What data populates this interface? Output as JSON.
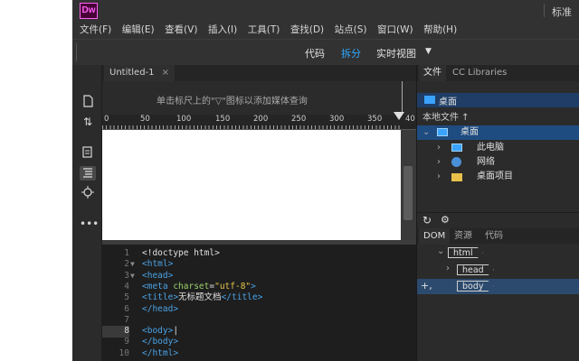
{
  "app": {
    "logo": "Dw",
    "workspace": "标准"
  },
  "menu": [
    "文件(F)",
    "编辑(E)",
    "查看(V)",
    "插入(I)",
    "工具(T)",
    "查找(D)",
    "站点(S)",
    "窗口(W)",
    "帮助(H)"
  ],
  "views": {
    "code": "代码",
    "split": "拆分",
    "live": "实时视图",
    "active": "拆分"
  },
  "document": {
    "tab_title": "Untitled-1",
    "tab_close": "×",
    "media_query_hint": "单击标尺上的\"▽\"图标以添加媒体查询"
  },
  "ruler": [
    "0",
    "50",
    "100",
    "150",
    "200",
    "250",
    "300",
    "350",
    "40"
  ],
  "code": [
    {
      "n": "1",
      "fold": "",
      "parts": [
        [
          "t-txt",
          "<!doctype html>"
        ]
      ]
    },
    {
      "n": "2",
      "fold": "▼",
      "parts": [
        [
          "t-tag",
          "<html>"
        ]
      ]
    },
    {
      "n": "3",
      "fold": "▼",
      "parts": [
        [
          "t-tag",
          "<head>"
        ]
      ]
    },
    {
      "n": "4",
      "fold": "",
      "parts": [
        [
          "t-tag",
          "<meta "
        ],
        [
          "t-attr",
          "charset"
        ],
        [
          "t-txt",
          "="
        ],
        [
          "t-str",
          "\"utf-8\""
        ],
        [
          "t-tag",
          ">"
        ]
      ]
    },
    {
      "n": "5",
      "fold": "",
      "parts": [
        [
          "t-tag",
          "<title>"
        ],
        [
          "t-txt",
          "无标题文档"
        ],
        [
          "t-tag",
          "</title>"
        ]
      ]
    },
    {
      "n": "6",
      "fold": "",
      "parts": [
        [
          "t-tag",
          "</head>"
        ]
      ]
    },
    {
      "n": "7",
      "fold": "",
      "parts": []
    },
    {
      "n": "8",
      "fold": "",
      "parts": [
        [
          "t-tag",
          "<body>"
        ],
        [
          "t-txt",
          "|"
        ]
      ],
      "highlight": true
    },
    {
      "n": "9",
      "fold": "",
      "parts": [
        [
          "t-tag",
          "</body>"
        ]
      ]
    },
    {
      "n": "10",
      "fold": "",
      "parts": [
        [
          "t-tag",
          "</html>"
        ]
      ]
    }
  ],
  "files_panel": {
    "tabs": [
      "文件",
      "CC Libraries"
    ],
    "location": "桌面",
    "local_files_label": "本地文件 ↑",
    "tree": [
      {
        "label": "桌面",
        "icon": "desktop-icon",
        "level": 0,
        "expanded": true,
        "selected": true
      },
      {
        "label": "此电脑",
        "icon": "computer-icon",
        "level": 1
      },
      {
        "label": "网络",
        "icon": "network-icon",
        "level": 1
      },
      {
        "label": "桌面项目",
        "icon": "folder-icon",
        "level": 1
      }
    ]
  },
  "dom_panel": {
    "tabs": [
      "DOM",
      "资源",
      "代码"
    ],
    "nodes": [
      {
        "label": "html",
        "level": 0
      },
      {
        "label": "head",
        "level": 1
      },
      {
        "label": "body",
        "level": 1,
        "selected": true
      }
    ],
    "add_symbol": "+,"
  },
  "colors": {
    "accent": "#2fa9ff",
    "logo_bg": "#470137",
    "logo_fg": "#ff61f6",
    "selection": "#1f4c80"
  }
}
